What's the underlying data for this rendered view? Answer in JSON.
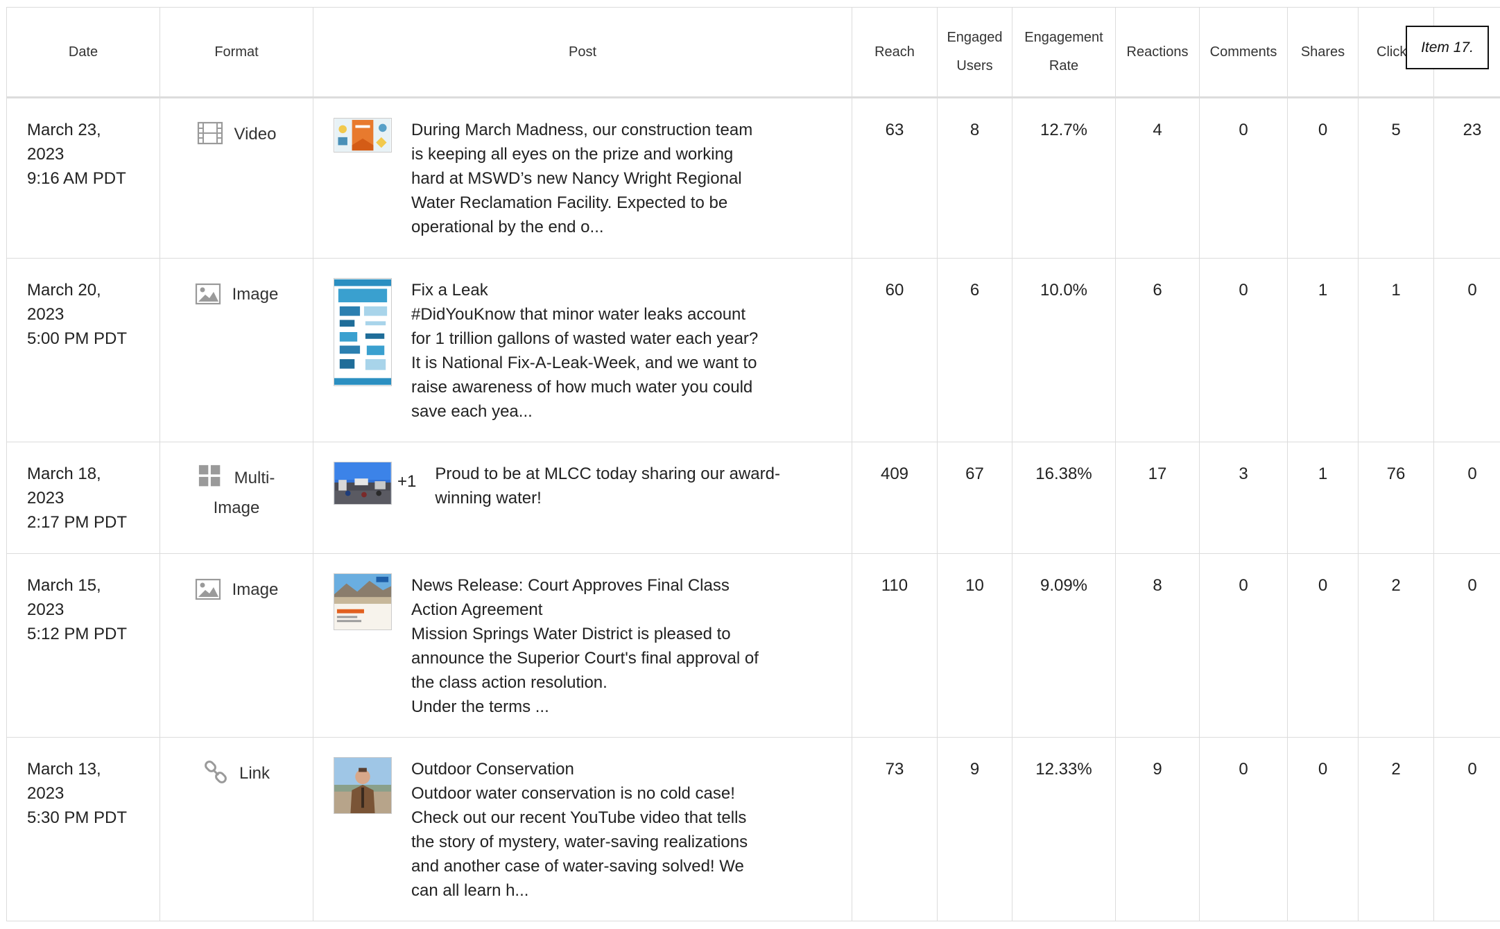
{
  "columns": [
    "Date",
    "Format",
    "Post",
    "Reach",
    "Engaged Users",
    "Engagement Rate",
    "Reactions",
    "Comments",
    "Shares",
    "Click",
    ""
  ],
  "tooltip": "Item 17.",
  "rows": [
    {
      "date": [
        "March 23,",
        "2023",
        "9:16 AM PDT"
      ],
      "format": "Video",
      "format_icon": "video-film-icon",
      "post": [
        "During March Madness, our construction team",
        "is keeping all eyes on the prize and working",
        "hard at MSWD’s new Nancy Wright Regional",
        "Water Reclamation Facility. Expected to be",
        "operational by the end o..."
      ],
      "reach": "63",
      "engaged_users": "8",
      "engagement_rate": "12.7%",
      "reactions": "4",
      "comments": "0",
      "shares": "0",
      "clicks": "5",
      "extra": "23"
    },
    {
      "date": [
        "March 20,",
        "2023",
        "5:00 PM PDT"
      ],
      "format": "Image",
      "format_icon": "image-icon",
      "post": [
        "Fix a Leak",
        "#DidYouKnow that minor water leaks account",
        "for 1 trillion gallons of wasted water each year?",
        "It is National Fix-A-Leak-Week, and we want to",
        "raise awareness of how much water you could",
        "save each yea..."
      ],
      "reach": "60",
      "engaged_users": "6",
      "engagement_rate": "10.0%",
      "reactions": "6",
      "comments": "0",
      "shares": "1",
      "clicks": "1",
      "extra": "0"
    },
    {
      "date": [
        "March 18,",
        "2023",
        "2:17 PM PDT"
      ],
      "format": [
        "Multi-",
        "Image"
      ],
      "format_icon": "multi-image-grid-icon",
      "plus_more": "+1",
      "post": [
        "Proud to be at MLCC today sharing our award-",
        "winning water!"
      ],
      "reach": "409",
      "engaged_users": "67",
      "engagement_rate": "16.38%",
      "reactions": "17",
      "comments": "3",
      "shares": "1",
      "clicks": "76",
      "extra": "0"
    },
    {
      "date": [
        "March 15,",
        "2023",
        "5:12 PM PDT"
      ],
      "format": "Image",
      "format_icon": "image-icon",
      "post": [
        "News Release: Court Approves Final Class",
        "Action Agreement",
        "Mission Springs Water District is pleased to",
        "announce the Superior Court's final approval of",
        "the class action resolution.",
        "Under the terms ..."
      ],
      "reach": "110",
      "engaged_users": "10",
      "engagement_rate": "9.09%",
      "reactions": "8",
      "comments": "0",
      "shares": "0",
      "clicks": "2",
      "extra": "0"
    },
    {
      "date": [
        "March 13,",
        "2023",
        "5:30 PM PDT"
      ],
      "format": "Link",
      "format_icon": "link-chain-icon",
      "post": [
        "Outdoor Conservation",
        "Outdoor water conservation is no cold case!",
        "Check out our recent YouTube video that tells",
        "the story of mystery, water-saving realizations",
        "and another case of water-saving solved! We",
        "can all learn h..."
      ],
      "reach": "73",
      "engaged_users": "9",
      "engagement_rate": "12.33%",
      "reactions": "9",
      "comments": "0",
      "shares": "0",
      "clicks": "2",
      "extra": "0"
    }
  ]
}
